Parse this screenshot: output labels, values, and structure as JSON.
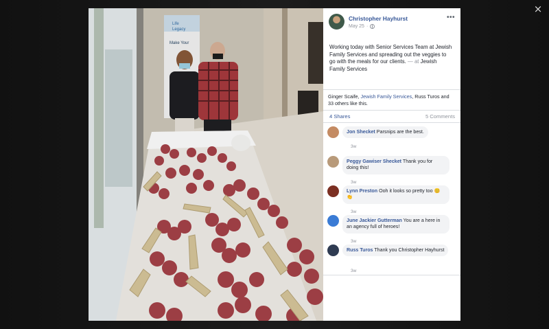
{
  "viewer": {
    "close_icon": "×"
  },
  "post": {
    "author": "Christopher Hayhurst",
    "date": "May 25",
    "audience_icon": "globe-icon",
    "more_icon": "•••",
    "text": "Working today with Senior Services Team at Jewish Family Services and spreading out the veggies to go with the meals for our clients.",
    "location_prefix": " — at ",
    "location": "Jewish Family Services"
  },
  "photo": {
    "banner_line1": "Life",
    "banner_line2": "Legacy",
    "banner_line3": "Make Your"
  },
  "reactions": {
    "names_before": "Ginger Scaife, ",
    "link": "Jewish Family Services",
    "names_after": ", Russ Turos and 33 others like this."
  },
  "counts": {
    "shares": "4 Shares",
    "comments": "5 Comments"
  },
  "comments": [
    {
      "author": "Jon Shecket",
      "text": "Parsnips are the best.",
      "ago": "3w",
      "avatar_color": "#c48b63"
    },
    {
      "author": "Peggy Gawiser Shecket",
      "text": "Thank you for doing this!",
      "ago": "3w",
      "avatar_color": "#b89a7a"
    },
    {
      "author": "Lynn Preston",
      "text": "Ooh it looks so pretty too 😊👏",
      "ago": "3w",
      "avatar_color": "#7b2f22"
    },
    {
      "author": "June Jackier Gutterman",
      "text": "You are a here in an agency full of heroes!",
      "ago": "3w",
      "avatar_color": "#3a7bd5"
    },
    {
      "author": "Russ Turos",
      "text": "Thank you Christopher Hayhurst",
      "ago": "3w",
      "avatar_color": "#2f3b52"
    }
  ]
}
